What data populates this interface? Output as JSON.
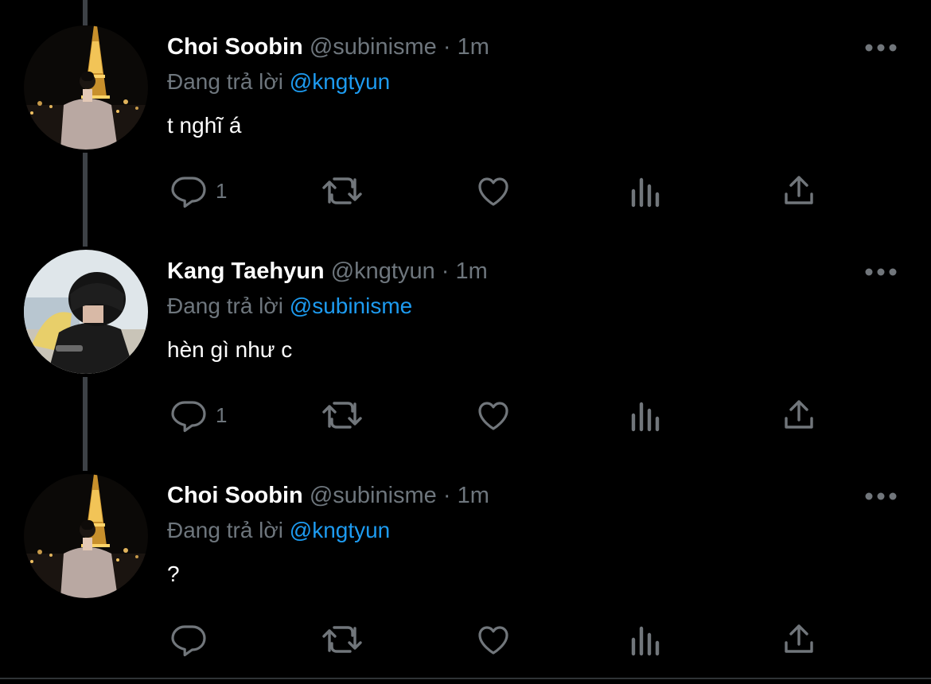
{
  "tweets": [
    {
      "name": "Choi Soobin",
      "handle": "@subinisme",
      "separator": "·",
      "time": "1m",
      "reply_prefix": "Đang trả lời",
      "reply_to": "@kngtyun",
      "text": "t nghĩ á",
      "reply_count": "1",
      "avatar": "eiffel-night-portrait"
    },
    {
      "name": "Kang Taehyun",
      "handle": "@kngtyun",
      "separator": "·",
      "time": "1m",
      "reply_prefix": "Đang trả lời",
      "reply_to": "@subinisme",
      "text": "hèn gì như c",
      "reply_count": "1",
      "avatar": "indoor-black-sweater-portrait"
    },
    {
      "name": "Choi Soobin",
      "handle": "@subinisme",
      "separator": "·",
      "time": "1m",
      "reply_prefix": "Đang trả lời",
      "reply_to": "@kngtyun",
      "text": "?",
      "reply_count": "",
      "avatar": "eiffel-night-portrait"
    }
  ],
  "icons": {
    "reply": "reply-icon",
    "retweet": "retweet-icon",
    "like": "like-icon",
    "views": "views-icon",
    "share": "share-icon",
    "more": "more-options-icon"
  },
  "colors": {
    "background": "#000000",
    "name": "#ffffff",
    "secondary": "#6e767d",
    "mention": "#1d9bf0",
    "icon": "#71767b",
    "thread_line": "#3d4146"
  }
}
